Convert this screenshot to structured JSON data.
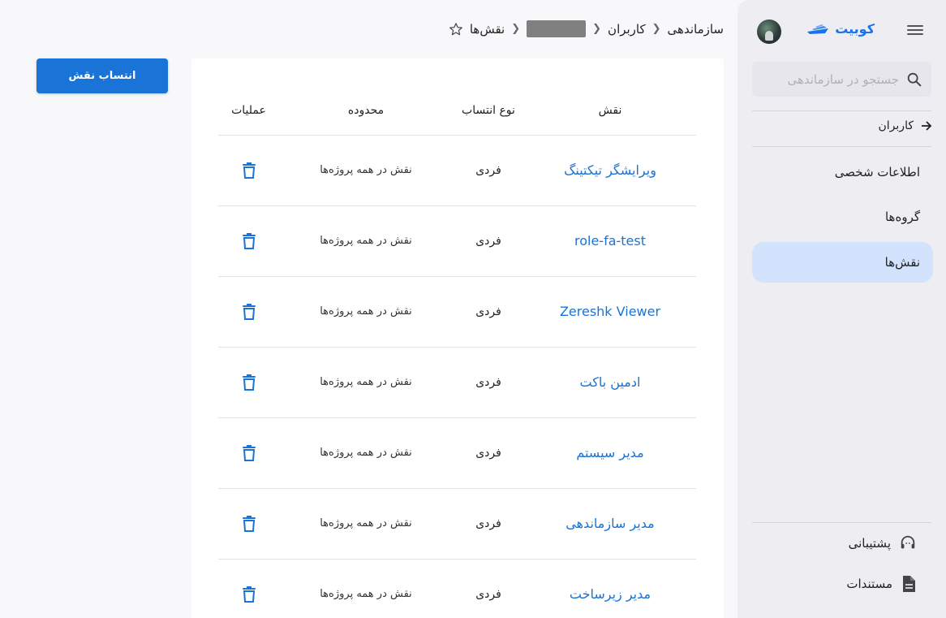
{
  "sidebar": {
    "brand": "کوبیت",
    "search_placeholder": "جستجو در سازماندهی",
    "back_label": "کاربران",
    "items": [
      {
        "label": "اطلاعات شخصی",
        "active": false
      },
      {
        "label": "گروه‌ها",
        "active": false
      },
      {
        "label": "نقش‌ها",
        "active": true
      }
    ],
    "footer": {
      "support": "پشتیبانی",
      "docs": "مستندات"
    }
  },
  "breadcrumb": {
    "org": "سازماندهی",
    "users": "کاربران",
    "roles": "نقش‌ها"
  },
  "actions": {
    "assign_role": "انتساب نقش"
  },
  "table": {
    "headers": {
      "role": "نقش",
      "type": "نوع انتساب",
      "scope": "محدوده",
      "ops": "عملیات"
    },
    "rows": [
      {
        "role": "ویرایشگر تیکتینگ",
        "type": "فردی",
        "scope": "نقش در همه پروژه‌ها"
      },
      {
        "role": "role-fa-test",
        "type": "فردی",
        "scope": "نقش در همه پروژه‌ها"
      },
      {
        "role": "Zereshk Viewer",
        "type": "فردی",
        "scope": "نقش در همه پروژه‌ها"
      },
      {
        "role": "ادمین باکت",
        "type": "فردی",
        "scope": "نقش در همه پروژه‌ها"
      },
      {
        "role": "مدیر سیستم",
        "type": "فردی",
        "scope": "نقش در همه پروژه‌ها"
      },
      {
        "role": "مدیر سازماندهی",
        "type": "فردی",
        "scope": "نقش در همه پروژه‌ها"
      },
      {
        "role": "مدیر زیرساخت",
        "type": "فردی",
        "scope": "نقش در همه پروژه‌ها"
      }
    ]
  },
  "colors": {
    "accent": "#1a73d6",
    "active_nav": "#d3e3fd",
    "sidebar_bg": "#ededf2"
  }
}
